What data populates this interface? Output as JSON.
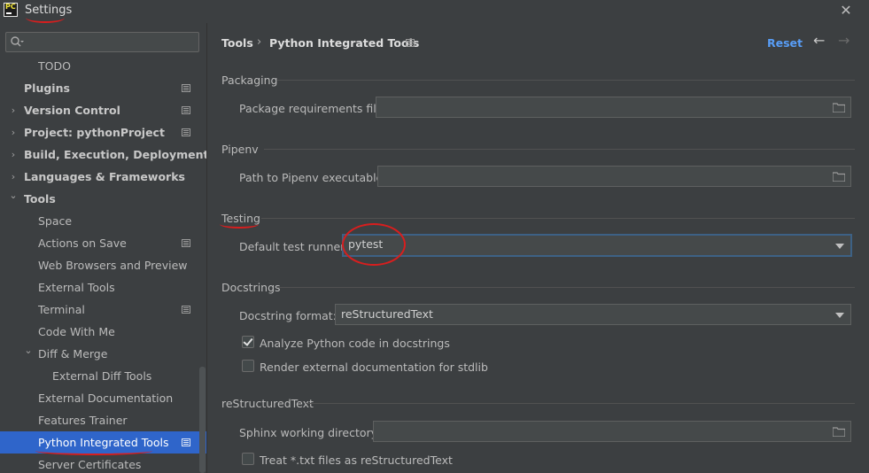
{
  "window": {
    "title": "Settings",
    "close_glyph": "✕"
  },
  "sidebar": {
    "search_placeholder": "",
    "items": [
      {
        "label": "TODO"
      },
      {
        "label": "Plugins"
      },
      {
        "label": "Version Control"
      },
      {
        "label": "Project: pythonProject"
      },
      {
        "label": "Build, Execution, Deployment"
      },
      {
        "label": "Languages & Frameworks"
      },
      {
        "label": "Tools"
      },
      {
        "label": "Space"
      },
      {
        "label": "Actions on Save"
      },
      {
        "label": "Web Browsers and Preview"
      },
      {
        "label": "External Tools"
      },
      {
        "label": "Terminal"
      },
      {
        "label": "Code With Me"
      },
      {
        "label": "Diff & Merge"
      },
      {
        "label": "External Diff Tools"
      },
      {
        "label": "External Documentation"
      },
      {
        "label": "Features Trainer"
      },
      {
        "label": "Python Integrated Tools"
      },
      {
        "label": "Server Certificates"
      }
    ],
    "chevron_right": "›",
    "chevron_down": "⌄"
  },
  "header": {
    "breadcrumb": [
      "Tools",
      "Python Integrated Tools"
    ],
    "breadcrumb_sep": "›",
    "reset_label": "Reset",
    "back_glyph": "←",
    "forward_glyph": "→"
  },
  "sections": {
    "packaging": {
      "title": "Packaging",
      "requirements_label": "Package requirements file:",
      "requirements_value": ""
    },
    "pipenv": {
      "title": "Pipenv",
      "path_label": "Path to Pipenv executable:",
      "path_value": ""
    },
    "testing": {
      "title": "Testing",
      "runner_label": "Default test runner:",
      "runner_value": "pytest"
    },
    "docstrings": {
      "title": "Docstrings",
      "format_label": "Docstring format:",
      "format_value": "reStructuredText",
      "analyze_label": "Analyze Python code in docstrings",
      "analyze_checked": true,
      "render_label": "Render external documentation for stdlib",
      "render_checked": false
    },
    "restructuredtext": {
      "title": "reStructuredText",
      "sphinx_label": "Sphinx working directory:",
      "sphinx_value": "",
      "treat_label": "Treat *.txt files as reStructuredText",
      "treat_checked": false
    }
  },
  "colors": {
    "accent": "#2f65ca",
    "link": "#589df6",
    "annotation": "#d81e1e"
  }
}
